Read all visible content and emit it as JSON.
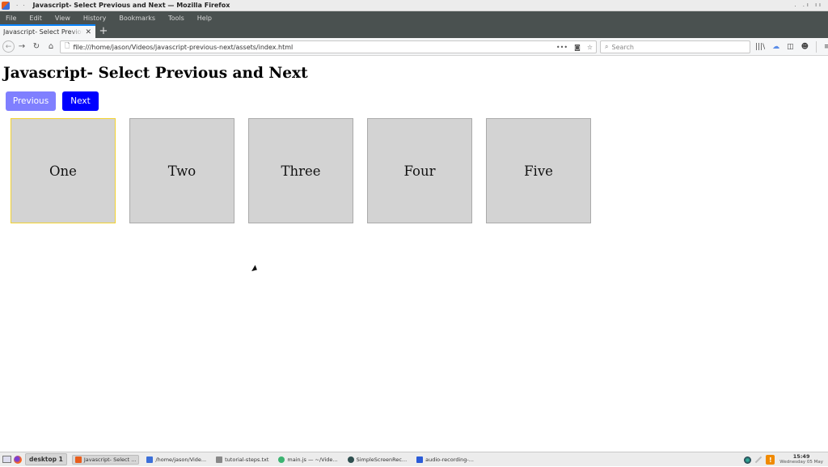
{
  "window": {
    "title": "Javascript- Select Previous and Next — Mozilla Firefox",
    "controls": ". .ı ıı"
  },
  "menubar": {
    "items": [
      "File",
      "Edit",
      "View",
      "History",
      "Bookmarks",
      "Tools",
      "Help"
    ]
  },
  "tabs": [
    {
      "label": "Javascript- Select Previous and Next",
      "active": true,
      "close": "✕"
    }
  ],
  "new_tab_label": "+",
  "navbar": {
    "back": "←",
    "forward": "→",
    "reload": "↻",
    "home": "⌂",
    "url": "file:///home/jason/Videos/javascript-previous-next/assets/index.html",
    "page_actions": "•••",
    "pocket": "◙",
    "bookmark": "☆",
    "search_placeholder": "Search",
    "search_icon": "🔍",
    "library": "|||\\",
    "sync": "☁",
    "sidebar": "◫",
    "account": "☻",
    "menu": "≡"
  },
  "page": {
    "heading": "Javascript- Select Previous and Next",
    "buttons": {
      "previous": "Previous",
      "next": "Next"
    },
    "colors": {
      "previous_bg": "#7f7fff",
      "next_bg": "#0000ff",
      "selected_border": "#f2d230",
      "box_bg": "#d3d3d3"
    },
    "boxes": [
      {
        "label": "One",
        "selected": true
      },
      {
        "label": "Two",
        "selected": false
      },
      {
        "label": "Three",
        "selected": false
      },
      {
        "label": "Four",
        "selected": false
      },
      {
        "label": "Five",
        "selected": false
      }
    ]
  },
  "taskbar": {
    "desktop": "desktop 1",
    "tasks": [
      {
        "label": "Javascript- Select ...",
        "active": true,
        "color": "#e85d1c"
      },
      {
        "label": "/home/jason/Vide...",
        "active": false,
        "color": "#3b6fd8"
      },
      {
        "label": "tutorial-steps.txt",
        "active": false,
        "color": "#888888"
      },
      {
        "label": "main.js — ~/Vide...",
        "active": false,
        "color": "#3cb371"
      },
      {
        "label": "SimpleScreenRec...",
        "active": false,
        "color": "#2f4f4f"
      },
      {
        "label": "audio-recording-...",
        "active": false,
        "color": "#2a5bd7"
      }
    ],
    "tray": {
      "warning": "!",
      "time": "15:49",
      "date": "Wednesday 05 May"
    }
  }
}
